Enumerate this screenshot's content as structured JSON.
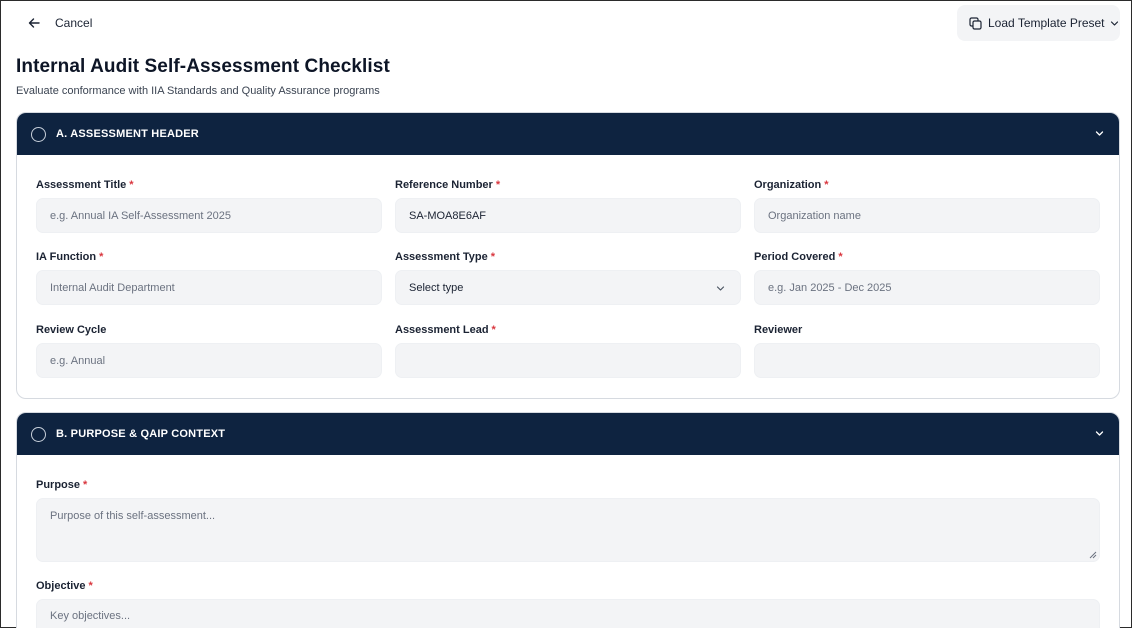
{
  "topbar": {
    "cancel_label": "Cancel",
    "preset_label": "Load Template Preset"
  },
  "page": {
    "title": "Internal Audit Self-Assessment Checklist",
    "subtitle": "Evaluate conformance with IIA Standards and Quality Assurance programs"
  },
  "sections": {
    "a": {
      "title": "A. ASSESSMENT HEADER",
      "fields": {
        "assessment_title": {
          "label": "Assessment Title",
          "required": "*",
          "value": "",
          "placeholder": "e.g. Annual IA Self-Assessment 2025"
        },
        "reference_number": {
          "label": "Reference Number",
          "required": "*",
          "value": "SA-MOA8E6AF",
          "placeholder": ""
        },
        "organization": {
          "label": "Organization",
          "required": "*",
          "value": "",
          "placeholder": "Organization name"
        },
        "ia_function": {
          "label": "IA Function",
          "required": "*",
          "value": "",
          "placeholder": "Internal Audit Department"
        },
        "assessment_type": {
          "label": "Assessment Type",
          "required": "*",
          "selected": "Select type"
        },
        "period_covered": {
          "label": "Period Covered",
          "required": "*",
          "value": "",
          "placeholder": "e.g. Jan 2025 - Dec 2025"
        },
        "review_cycle": {
          "label": "Review Cycle",
          "value": "",
          "placeholder": "e.g. Annual"
        },
        "assessment_lead": {
          "label": "Assessment Lead",
          "required": "*",
          "value": "",
          "placeholder": ""
        },
        "reviewer": {
          "label": "Reviewer",
          "value": "",
          "placeholder": ""
        }
      }
    },
    "b": {
      "title": "B. PURPOSE & QAIP CONTEXT",
      "fields": {
        "purpose": {
          "label": "Purpose",
          "required": "*",
          "placeholder": "Purpose of this self-assessment..."
        },
        "objective": {
          "label": "Objective",
          "required": "*",
          "placeholder": "Key objectives..."
        }
      }
    }
  },
  "icons": {
    "back": "arrow-left-icon",
    "copy": "copy-icon",
    "chevron": "chevron-down-icon",
    "status": "circle-icon"
  },
  "colors": {
    "header_bg": "#0e2340",
    "required": "#d9363e",
    "input_bg": "#f3f4f6"
  }
}
